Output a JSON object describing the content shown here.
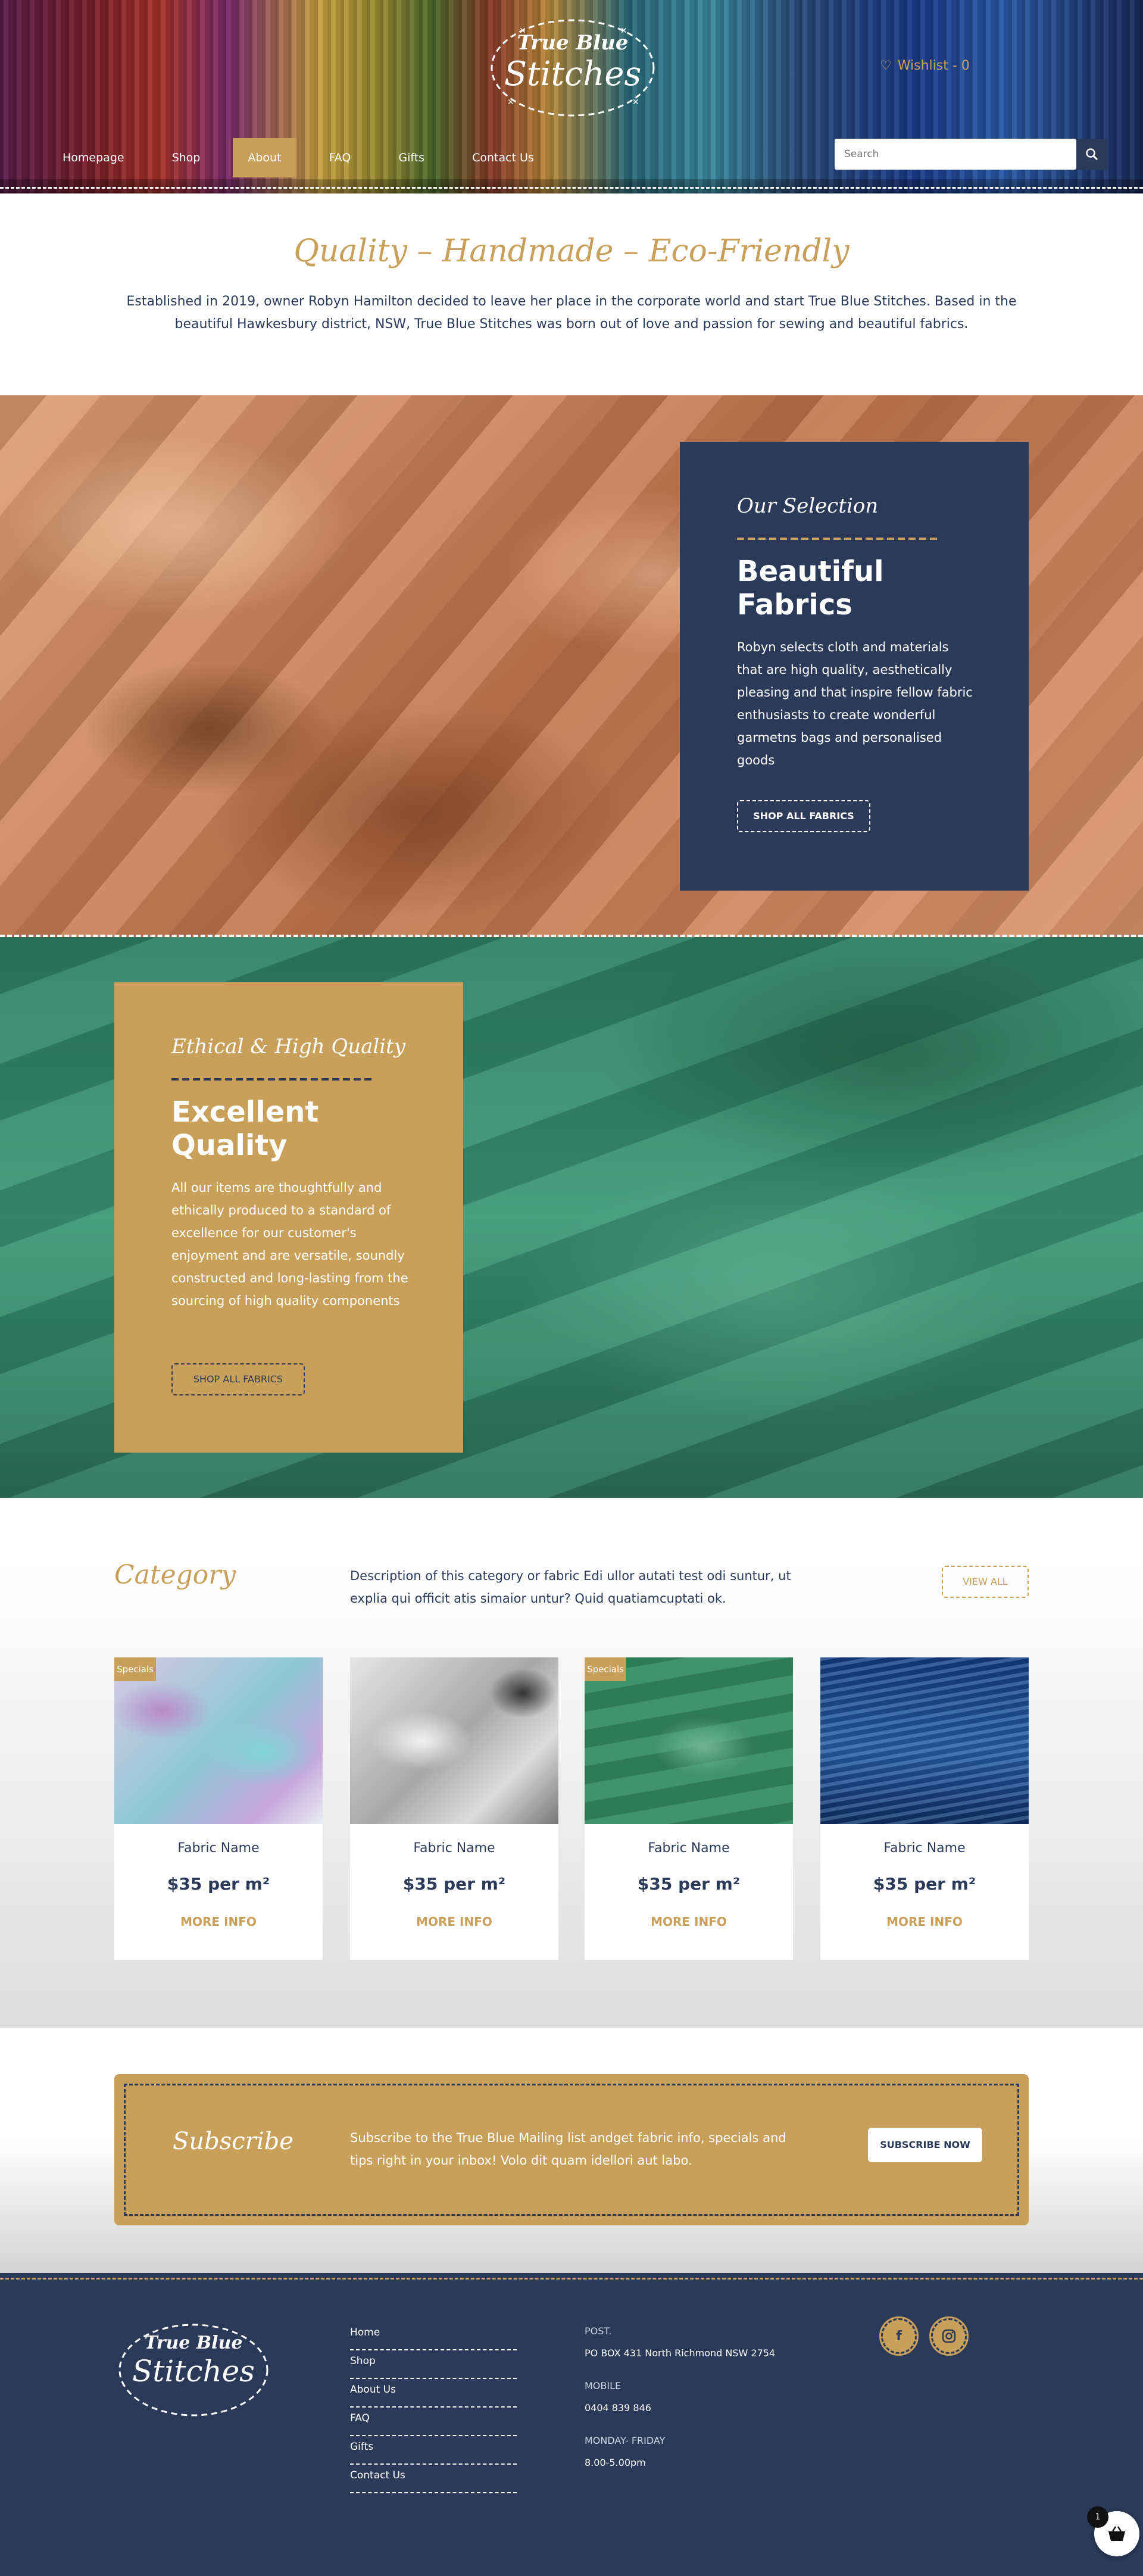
{
  "header": {
    "logo_line1": "True Blue",
    "logo_line2": "Stitches",
    "wishlist": "Wishlist - 0",
    "nav": [
      {
        "label": "Homepage"
      },
      {
        "label": "Shop"
      },
      {
        "label": "About",
        "active": true
      },
      {
        "label": "FAQ"
      },
      {
        "label": "Gifts"
      },
      {
        "label": "Contact Us"
      }
    ],
    "search_placeholder": "Search"
  },
  "intro": {
    "title": "Quality – Handmade – Eco-Friendly",
    "text": "Established in 2019, owner Robyn Hamilton decided to leave her place in the corporate world and start True Blue Stitches. Based in the beautiful Hawkesbury district, NSW, True Blue Stitches was born out of love and passion for sewing and beautiful fabrics."
  },
  "selection": {
    "kicker": "Our Selection",
    "heading": "Beautiful Fabrics",
    "body": "Robyn selects cloth and materials that are high quality, aesthetically pleasing and that inspire fellow fabric enthusiasts to create wonderful garmetns bags and personalised goods",
    "button": "SHOP ALL FABRICS"
  },
  "quality": {
    "kicker": "Ethical & High Quality",
    "heading": "Excellent Quality",
    "body": "All our items are thoughtfully and ethically produced to a standard of excellence for our customer's enjoyment and are versatile, soundly constructed and long-lasting from the sourcing of high quality components",
    "button": "SHOP ALL FABRICS"
  },
  "category": {
    "title": "Category",
    "description": "Description of this category or fabric Edi ullor autati test odi suntur, ut explia qui officit atis simaior untur? Quid quatiamcuptati ok.",
    "view_all": "VIEW ALL",
    "products": [
      {
        "badge": "Specials",
        "name": "Fabric Name",
        "price": "$35 per m²",
        "more": "MORE INFO"
      },
      {
        "badge": "",
        "name": "Fabric Name",
        "price": "$35 per m²",
        "more": "MORE INFO"
      },
      {
        "badge": "Specials",
        "name": "Fabric Name",
        "price": "$35 per m²",
        "more": "MORE INFO"
      },
      {
        "badge": "",
        "name": "Fabric Name",
        "price": "$35 per m²",
        "more": "MORE INFO"
      }
    ]
  },
  "subscribe": {
    "title": "Subscribe",
    "text": "Subscribe to the True Blue Mailing list andget fabric info, specials and tips right in your inbox! Volo dit quam idellori aut labo.",
    "button": "SUBSCRIBE NOW"
  },
  "footer": {
    "links": [
      {
        "label": "Home"
      },
      {
        "label": "Shop"
      },
      {
        "label": "About Us"
      },
      {
        "label": "FAQ"
      },
      {
        "label": "Gifts"
      },
      {
        "label": "Contact Us"
      }
    ],
    "post_label": "POST.",
    "post_value": "PO BOX 431 North Richmond NSW 2754",
    "mobile_label": "MOBILE",
    "mobile_value": "0404 839 846",
    "hours_label": "MONDAY- FRIDAY",
    "hours_value": "8.00-5.00pm"
  },
  "cart_count": "1",
  "colors": {
    "navy": "#2b3a59",
    "gold": "#c8a05a"
  }
}
